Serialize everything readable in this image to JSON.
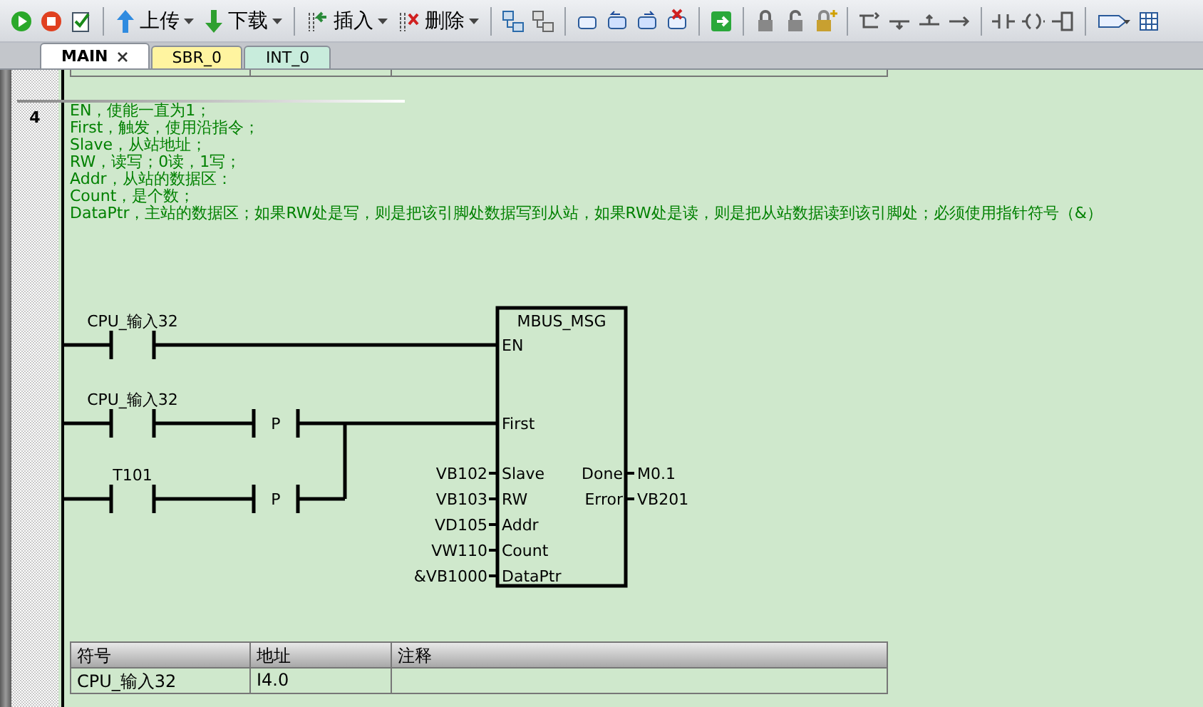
{
  "toolbar": {
    "buttons": [
      {
        "label": "上传",
        "kind": "upload"
      },
      {
        "label": "下载",
        "kind": "download"
      },
      {
        "label": "插入",
        "kind": "insert"
      },
      {
        "label": "删除",
        "kind": "delete"
      }
    ]
  },
  "tabs": [
    {
      "label": "MAIN",
      "selected": true,
      "color": "#ffffff"
    },
    {
      "label": "SBR_0",
      "selected": false,
      "color": "#fff4a0"
    },
    {
      "label": "INT_0",
      "selected": false,
      "color": "#c8ecdc"
    }
  ],
  "network": {
    "number": "4",
    "comment": [
      "EN，使能一直为1；",
      "First，触发，使用沿指令；",
      "Slave，从站地址；",
      "RW，读写；0读，1写；",
      "Addr，从站的数据区：",
      "Count，是个数；",
      "DataPtr，主站的数据区；如果RW处是写，则是把该引脚处数据写到从站，如果RW处是读，则是把从站数据读到该引脚处；必须使用指针符号（&）"
    ],
    "rungs": [
      {
        "contact": "CPU_输入32"
      },
      {
        "contact": "CPU_输入32",
        "edge_label": "P"
      },
      {
        "contact": "T101",
        "edge_label": "P"
      }
    ],
    "block": {
      "title": "MBUS_MSG",
      "enable": "EN",
      "trigger": "First",
      "inputs": [
        {
          "pin": "Slave",
          "operand": "VB102"
        },
        {
          "pin": "RW",
          "operand": "VB103"
        },
        {
          "pin": "Addr",
          "operand": "VD105"
        },
        {
          "pin": "Count",
          "operand": "VW110"
        },
        {
          "pin": "DataPtr",
          "operand": "&VB1000"
        }
      ],
      "outputs": [
        {
          "pin": "Done",
          "operand": "M0.1"
        },
        {
          "pin": "Error",
          "operand": "VB201"
        }
      ]
    }
  },
  "symbol_table": {
    "columns": [
      "符号",
      "地址",
      "注释"
    ],
    "rows": [
      [
        "CPU_输入32",
        "I4.0",
        ""
      ]
    ]
  }
}
